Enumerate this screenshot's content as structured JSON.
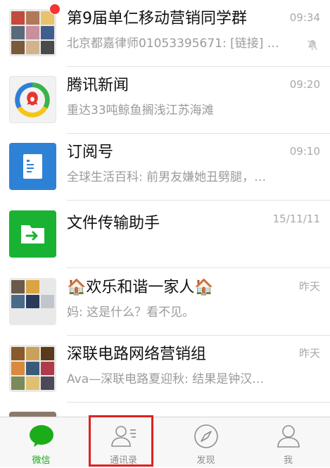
{
  "chats": [
    {
      "title": "第9届单仁移动营销同学群",
      "preview": "北京都嘉律师01053395671: [链接] …",
      "time": "09:34",
      "icon": "group-avatar-grid",
      "muted": true,
      "unread_badge": true
    },
    {
      "title": "腾讯新闻",
      "preview": "重达33吨鲸鱼搁浅江苏海滩",
      "time": "09:20",
      "icon": "tencent-news-logo"
    },
    {
      "title": "订阅号",
      "preview": "全球生活百科: 前男友嫌她丑劈腿，…",
      "time": "09:10",
      "icon": "document-icon"
    },
    {
      "title": "文件传输助手",
      "preview": "",
      "time": "15/11/11",
      "icon": "folder-arrow-icon"
    },
    {
      "title": "欢乐和谐一家人",
      "title_emoji": "🏠",
      "preview": "妈: 这是什么？看不见。",
      "time": "昨天",
      "icon": "group-avatar-grid"
    },
    {
      "title": "深联电路网络营销组",
      "preview": "Ava—深联电路夏迎秋: 结果是钟汉…",
      "time": "昨天",
      "icon": "group-avatar-grid"
    }
  ],
  "tabbar": {
    "items": [
      {
        "label": "微信",
        "icon": "chat-bubble-icon",
        "active": true
      },
      {
        "label": "通讯录",
        "icon": "contacts-icon",
        "active": false,
        "highlighted": true
      },
      {
        "label": "发现",
        "icon": "compass-icon",
        "active": false
      },
      {
        "label": "我",
        "icon": "person-icon",
        "active": false
      }
    ]
  },
  "colors": {
    "accent": "#1aad19",
    "badge": "#f43530",
    "highlight": "#e02020"
  }
}
